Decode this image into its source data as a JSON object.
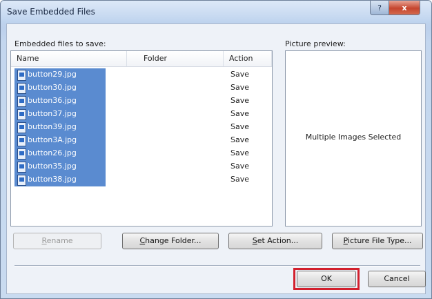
{
  "window": {
    "title": "Save Embedded Files",
    "help_glyph": "?",
    "close_glyph": "x"
  },
  "files_panel": {
    "label": "Embedded files to save:",
    "columns": [
      "Name",
      "Folder",
      "Action"
    ],
    "rows": [
      {
        "name": "button29.jpg",
        "folder": "",
        "action": "Save"
      },
      {
        "name": "button30.jpg",
        "folder": "",
        "action": "Save"
      },
      {
        "name": "button36.jpg",
        "folder": "",
        "action": "Save"
      },
      {
        "name": "button37.jpg",
        "folder": "",
        "action": "Save"
      },
      {
        "name": "button39.jpg",
        "folder": "",
        "action": "Save"
      },
      {
        "name": "button3A.jpg",
        "folder": "",
        "action": "Save"
      },
      {
        "name": "button26.jpg",
        "folder": "",
        "action": "Save"
      },
      {
        "name": "button35.jpg",
        "folder": "",
        "action": "Save"
      },
      {
        "name": "button38.jpg",
        "folder": "",
        "action": "Save"
      }
    ]
  },
  "preview_panel": {
    "label": "Picture preview:",
    "status_text": "Multiple Images Selected"
  },
  "buttons": {
    "rename": "Rename",
    "change_folder": "Change Folder...",
    "set_action": "Set Action...",
    "picture_file_type": "Picture File Type...",
    "ok": "OK",
    "cancel": "Cancel"
  },
  "colors": {
    "selection": "#5a8bd0",
    "highlight_box": "#d2202d"
  },
  "icons": {
    "file_row": "image-file-icon",
    "help": "help-icon",
    "close": "close-icon"
  }
}
